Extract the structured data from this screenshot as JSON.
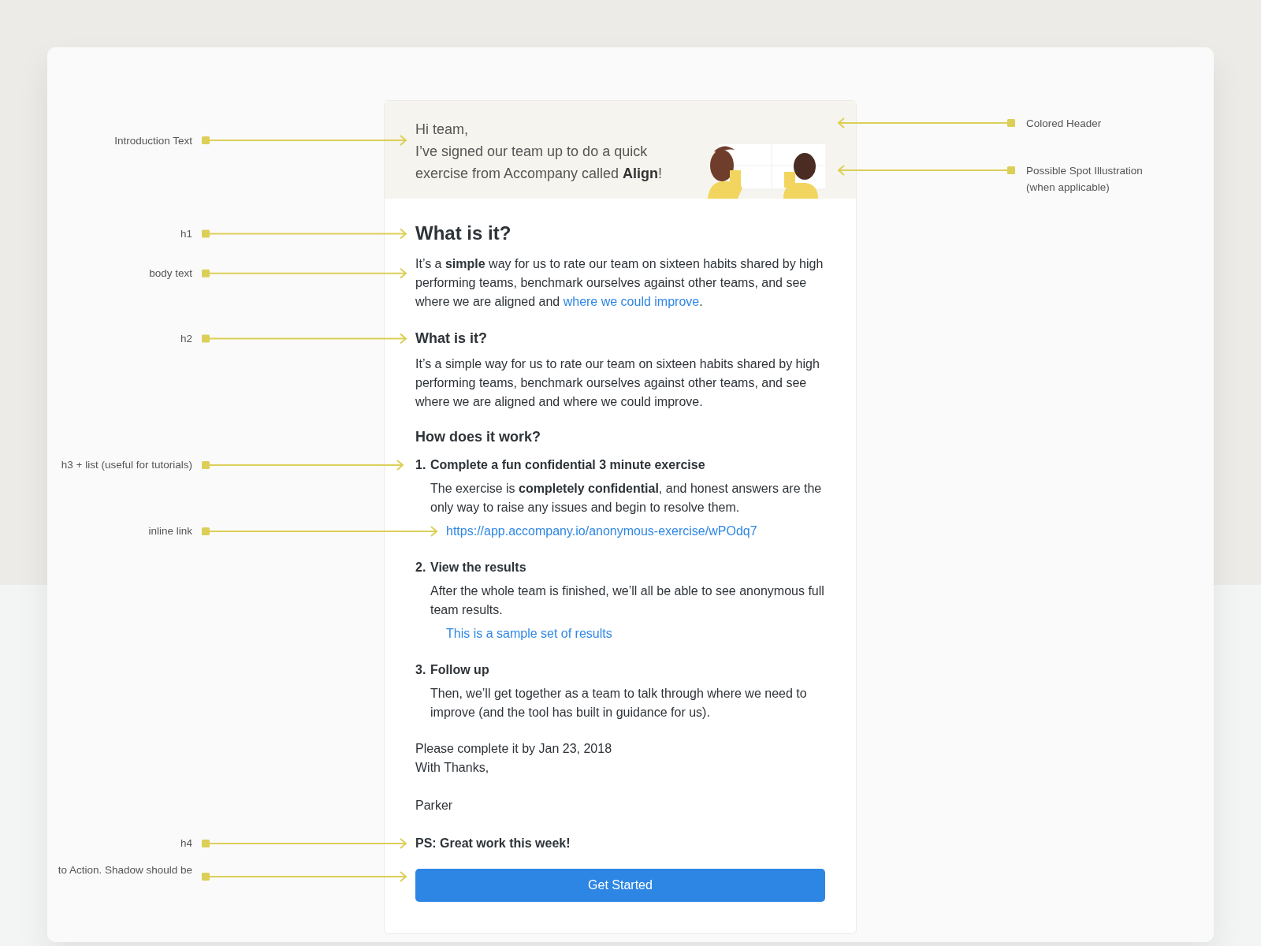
{
  "annotations_left": [
    {
      "text": "Introduction Text"
    },
    {
      "text": "h1"
    },
    {
      "text": "body text"
    },
    {
      "text": "h2"
    },
    {
      "text": "h3 + list (useful for tutorials)"
    },
    {
      "text": "inline link"
    },
    {
      "text": "h4"
    },
    {
      "text": "to Action. Shadow should be"
    }
  ],
  "annotations_right": [
    {
      "text": "Colored Header"
    },
    {
      "text": "Possible Spot Illustration (when applicable)"
    }
  ],
  "email": {
    "header": {
      "greeting": "Hi team,",
      "intro": "I’ve signed our team up to do a quick exercise from Accompany called **Align**!"
    },
    "h1": "What is it?",
    "body": {
      "text": "It’s a **simple** way for us to rate our team on sixteen habits shared by high performing teams, benchmark ourselves against other teams, and see where we are aligned and ",
      "link": "where we could improve",
      "after": "."
    },
    "h2": "What is it?",
    "h2_body": "It’s a simple way for us to rate our team on sixteen habits shared by high performing teams, benchmark ourselves against other teams, and see where we are aligned and where we could improve.",
    "h3": "How does it work?",
    "steps": [
      {
        "number": "1.",
        "title": "Complete a fun confidential 3 minute exercise",
        "body": "The exercise is **completely confidential**, and honest answers are the only way to raise any issues and begin to resolve them.",
        "link": "https://app.accompany.io/anonymous-exercise/wPOdq7"
      },
      {
        "number": "2.",
        "title": "View the results",
        "body": "After the whole team is finished, we’ll all be able to see anonymous full team results.",
        "link": "This is a sample set of results"
      },
      {
        "number": "3.",
        "title": "Follow up",
        "body": "Then, we’ll get together as a team to talk through where we need to improve (and the tool has built in guidance for us)."
      }
    ],
    "closing": [
      "Please complete it by Jan 23, 2018",
      "With Thanks,"
    ],
    "signature": "Parker",
    "h4": "PS: Great work this week!",
    "button": "Get Started"
  }
}
